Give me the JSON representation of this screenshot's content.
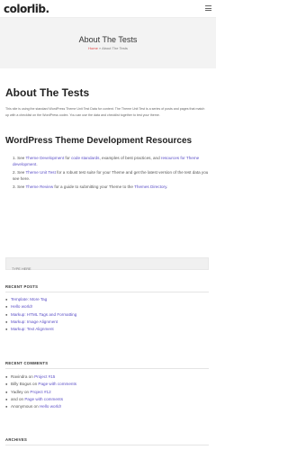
{
  "header": {
    "logo": "colorlib."
  },
  "hero": {
    "title": "About The Tests",
    "breadcrumb_home": "Home",
    "breadcrumb_sep": " » ",
    "breadcrumb_current": "About The Tests"
  },
  "main": {
    "title": "About The Tests",
    "intro": "This site is using the standard WordPress Theme Unit Test Data for content. The Theme Unit Test is a series of posts and pages that match up with a checklist on the WordPress codex. You can use the data and checklist together to test your theme.",
    "section_title": "WordPress Theme Development Resources",
    "resources": [
      {
        "num": "1.",
        "pre": "See ",
        "link1": "Theme Development",
        "mid": " for ",
        "link2": "code standards",
        "mid2": ", examples of best practices, and ",
        "link3": "resources for Theme development",
        "post": "."
      },
      {
        "num": "2.",
        "pre": "See ",
        "link1": "Theme Unit Test",
        "post": " for a robust test suite for your Theme and get the latest version of the test data you see here."
      },
      {
        "num": "3.",
        "pre": "See ",
        "link1": "Theme Review",
        "mid": " for a guide to submitting your Theme to the ",
        "link2": "Themes Directory",
        "post": "."
      }
    ]
  },
  "search": {
    "placeholder": "TYPE HERE"
  },
  "recent_posts": {
    "title": "RECENT POSTS",
    "items": [
      "Template: More Tag",
      "Hello world!",
      "Markup: HTML Tags and Formatting",
      "Markup: Image Alignment",
      "Markup: Text Alignment"
    ]
  },
  "recent_comments": {
    "title": "RECENT COMMENTS",
    "connector": "on",
    "items": [
      {
        "author": "Ravindra",
        "post": "Project #15"
      },
      {
        "author": "Billy Bogus",
        "post": "Page with comments"
      },
      {
        "author": "Yadley",
        "post": "Project #12"
      },
      {
        "author": "and",
        "post": "Page with comments"
      },
      {
        "author": "Anonymous",
        "post": "Hello world!"
      }
    ]
  },
  "archives": {
    "title": "ARCHIVES"
  },
  "colors": {
    "link": "#5b4fc7",
    "breadcrumb_home": "#dd4444",
    "hero_bg": "#f3f3f3"
  }
}
